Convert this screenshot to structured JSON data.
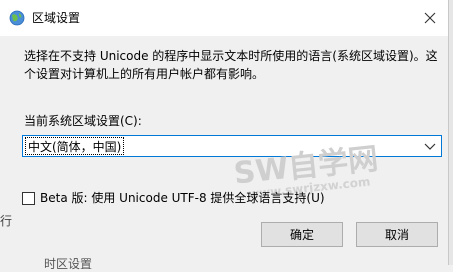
{
  "window": {
    "title": "区域设置",
    "description": "选择在不支持 Unicode 的程序中显示文本时所使用的语言(系统区域设置)。这个设置对计算机上的所有用户帐户都有影响。",
    "locale_label": "当前系统区域设置(C):",
    "locale_value": "中文(简体，中国)",
    "beta_checkbox": {
      "label": "Beta 版: 使用 Unicode UTF-8 提供全球语言支持(U)",
      "checked": false
    },
    "ok_label": "确定",
    "cancel_label": "取消"
  },
  "watermark": {
    "main": "SW自学网",
    "url": "www.swrjzxw.com"
  },
  "background": {
    "left_edge_char": "行",
    "bottom_fragment": "时区设置"
  },
  "icons": {
    "title": "globe-icon",
    "close": "close-icon",
    "dropdown": "chevron-down-icon"
  },
  "colors": {
    "accent_border": "#0078d7",
    "button_bg": "#e1e1e1",
    "watermark": "#c8c8c8"
  }
}
